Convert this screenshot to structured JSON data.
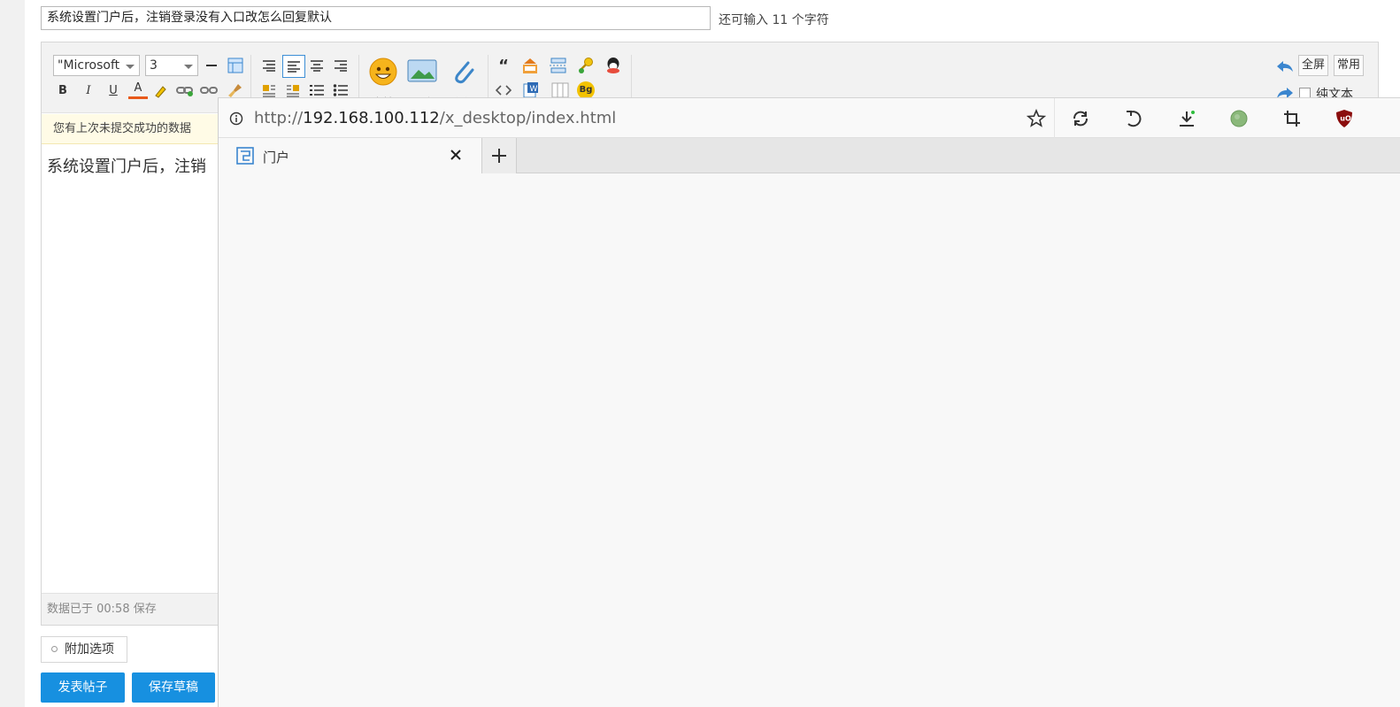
{
  "subject": {
    "value": "系统设置门户后，注销登录没有入口改怎么回复默认",
    "remaining": "还可输入 11 个字符"
  },
  "editor": {
    "font_select": "\"Microsoft",
    "size_select": "3",
    "buttons": {
      "emoji": "表情",
      "image": "图片",
      "attach": "附件",
      "fullscreen": "全屏",
      "common": "常用",
      "plaintext": "纯文本",
      "bold": "B",
      "italic": "I",
      "underline": "U",
      "fontcolor": "A",
      "quote": "“",
      "bg": "Bg"
    },
    "notice": "您有上次未提交成功的数据",
    "content": "系统设置门户后，注销",
    "status": "数据已于 00:58 保存"
  },
  "extra_options": "附加选项",
  "actions": {
    "post": "发表帖子",
    "draft": "保存草稿"
  },
  "browser": {
    "url_prefix": "http://",
    "url_host": "192.168.100.112",
    "url_path": "/x_desktop/index.html",
    "tab_title": "门户"
  },
  "colors": {
    "primary": "#1790e0",
    "notice_bg": "#fffbe6",
    "ublock": "#8b0d0d"
  }
}
